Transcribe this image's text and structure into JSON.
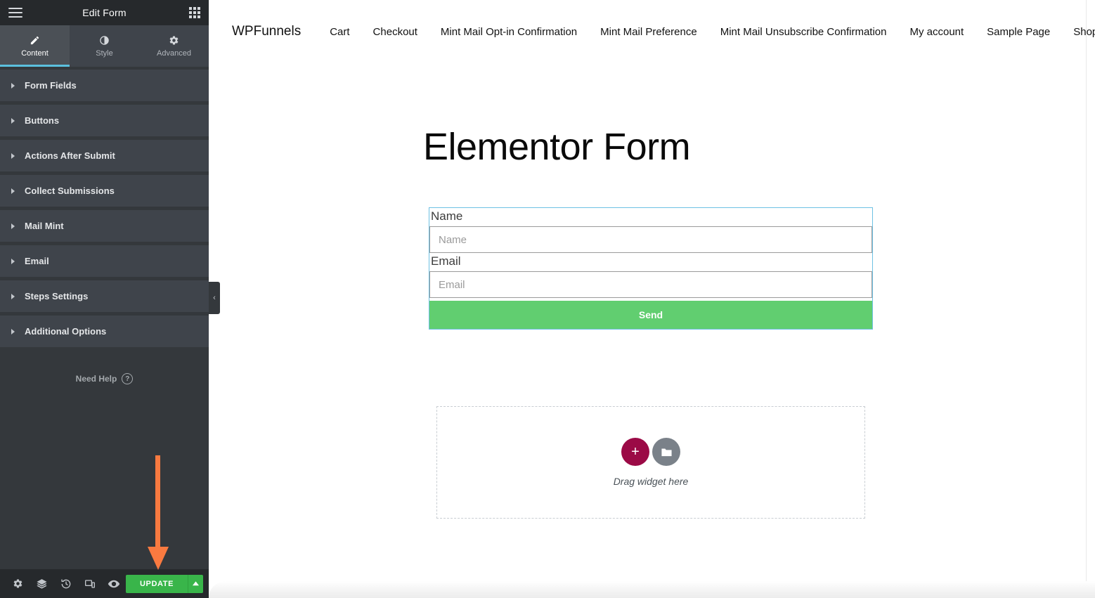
{
  "panel": {
    "title": "Edit Form",
    "menu_icon": "hamburger-icon",
    "widgets_icon": "grid-icon",
    "tabs": [
      {
        "label": "Content",
        "icon": "pencil-icon",
        "active": true
      },
      {
        "label": "Style",
        "icon": "contrast-icon",
        "active": false
      },
      {
        "label": "Advanced",
        "icon": "gear-icon",
        "active": false
      }
    ],
    "sections": [
      {
        "label": "Form Fields"
      },
      {
        "label": "Buttons"
      },
      {
        "label": "Actions After Submit"
      },
      {
        "label": "Collect Submissions"
      },
      {
        "label": "Mail Mint"
      },
      {
        "label": "Email"
      },
      {
        "label": "Steps Settings"
      },
      {
        "label": "Additional Options"
      }
    ],
    "need_help": {
      "label": "Need Help",
      "icon": "question-circle-icon"
    },
    "collapse_handle": "‹",
    "footer": {
      "icons": [
        {
          "name": "settings-gear-icon"
        },
        {
          "name": "navigator-layers-icon"
        },
        {
          "name": "history-icon"
        },
        {
          "name": "responsive-mode-icon"
        },
        {
          "name": "preview-eye-icon"
        }
      ],
      "update_label": "UPDATE",
      "update_caret": "▲",
      "update_color": "#39b54a"
    }
  },
  "annotation": {
    "arrow": "down-arrow-annotation",
    "color": "#f97a40"
  },
  "preview": {
    "site_nav": {
      "brand": "WPFunnels",
      "items": [
        "Cart",
        "Checkout",
        "Mint Mail Opt-in Confirmation",
        "Mint Mail Preference",
        "Mint Mail Unsubscribe Confirmation",
        "My account",
        "Sample Page",
        "Shop"
      ]
    },
    "heading": "Elementor Form",
    "form": {
      "selection_color": "#6ec1e4",
      "fields": [
        {
          "label": "Name",
          "placeholder": "Name",
          "value": ""
        },
        {
          "label": "Email",
          "placeholder": "Email",
          "value": ""
        }
      ],
      "submit_label": "Send",
      "submit_color": "#61ce70"
    },
    "drop_zone": {
      "add_icon": "plus-icon",
      "add_color": "#9b0a46",
      "folder_icon": "folder-icon",
      "folder_color": "#7a8189",
      "text": "Drag widget here"
    }
  }
}
